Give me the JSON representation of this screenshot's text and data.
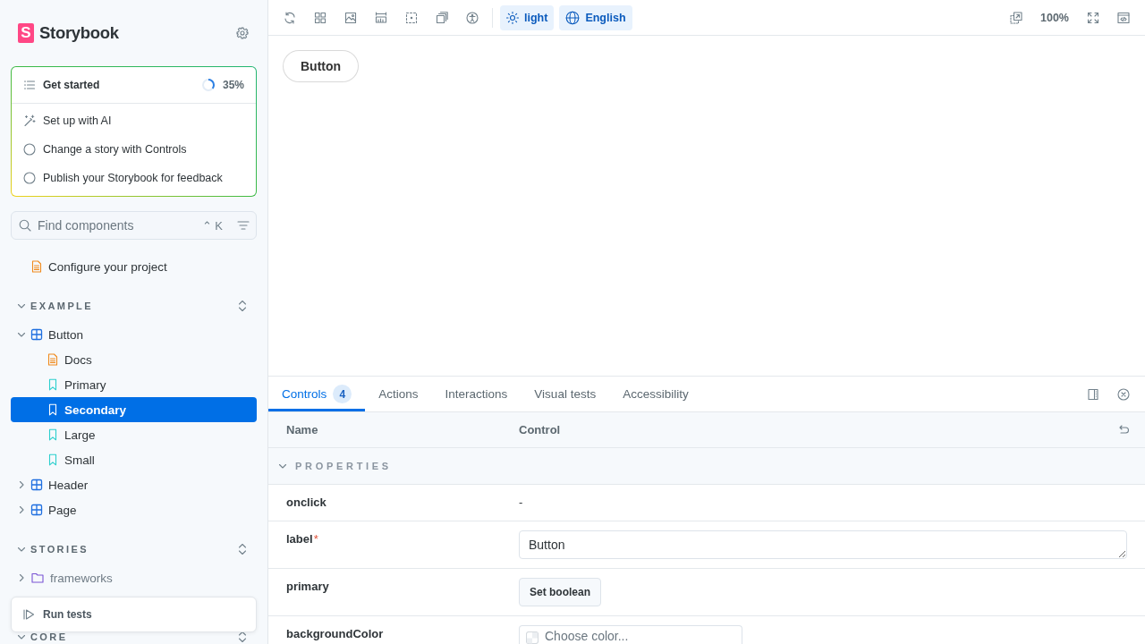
{
  "sidebar": {
    "logo_mark": "S",
    "brand": "Storybook",
    "checklist": {
      "title": "Get started",
      "progress": "35%",
      "level": 0.35,
      "items": [
        {
          "kind": "ai",
          "label": "Set up with AI",
          "checked": false
        },
        {
          "kind": "task",
          "label": "Change a story with Controls",
          "checked": false
        },
        {
          "kind": "task",
          "label": "Publish your Storybook for feedback",
          "checked": false
        }
      ]
    },
    "search": {
      "placeholder": "Find components",
      "shortcut": "⌃ K"
    },
    "tree": [
      {
        "kind": "doc",
        "label": "Configure your project",
        "selected": false
      },
      {
        "kind": "group",
        "label": "EXAMPLE",
        "expanded": true,
        "children": [
          {
            "kind": "component",
            "label": "Button",
            "expanded": true,
            "selected": false,
            "children": [
              {
                "kind": "doc",
                "label": "Docs",
                "selected": false
              },
              {
                "kind": "story",
                "label": "Primary",
                "selected": false
              },
              {
                "kind": "story",
                "label": "Secondary",
                "selected": true
              },
              {
                "kind": "story",
                "label": "Large",
                "selected": false
              },
              {
                "kind": "story",
                "label": "Small",
                "selected": false
              }
            ]
          },
          {
            "kind": "component",
            "label": "Header",
            "expanded": false,
            "selected": false
          },
          {
            "kind": "component",
            "label": "Page",
            "expanded": false,
            "selected": false
          }
        ]
      },
      {
        "kind": "group",
        "label": "STORIES",
        "expanded": true,
        "children": [
          {
            "kind": "folder",
            "label": "frameworks",
            "expanded": false,
            "selected": false
          }
        ]
      },
      {
        "kind": "group",
        "label": "CORE",
        "expanded": true
      }
    ],
    "run_tests": "Run tests"
  },
  "toolbar": {
    "globals": [
      {
        "kind": "theme",
        "label": "light",
        "active": true
      },
      {
        "kind": "locale",
        "label": "English",
        "active": true
      }
    ],
    "zoom": "100%"
  },
  "preview": {
    "button": "Button"
  },
  "panel": {
    "tabs": [
      {
        "label": "Controls",
        "badge": "4",
        "selected": true
      },
      {
        "label": "Actions",
        "selected": false
      },
      {
        "label": "Interactions",
        "selected": false
      },
      {
        "label": "Visual tests",
        "selected": false
      },
      {
        "label": "Accessibility",
        "selected": false
      }
    ],
    "table": {
      "columns": [
        "Name",
        "Control"
      ],
      "section": {
        "label": "PROPERTIES",
        "expanded": true
      },
      "rows": [
        {
          "name": "onclick",
          "kind": "none",
          "value": "-"
        },
        {
          "name": "label",
          "required_mark": "*",
          "kind": "text",
          "value": "Button"
        },
        {
          "name": "primary",
          "kind": "boolean",
          "button": "Set boolean"
        },
        {
          "name": "backgroundColor",
          "kind": "color",
          "placeholder": "Choose color..."
        }
      ]
    }
  }
}
